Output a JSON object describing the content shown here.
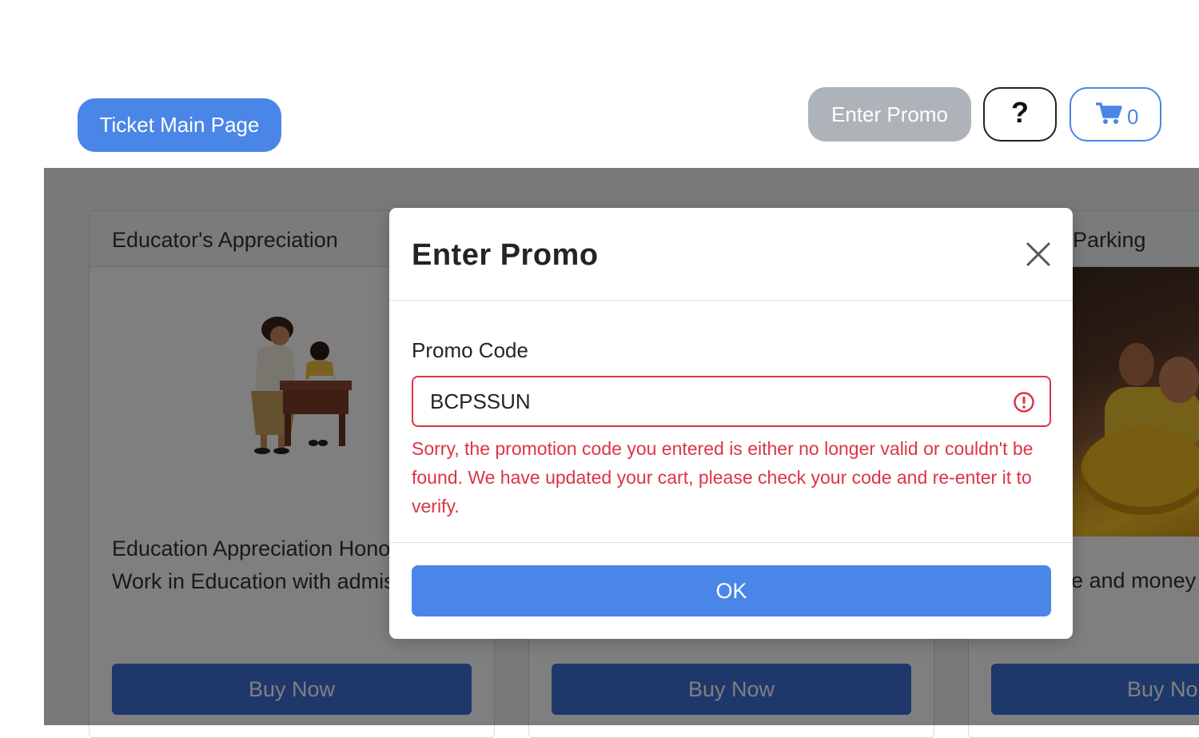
{
  "header": {
    "main_page_label": "Ticket Main Page",
    "enter_promo_label": "Enter Promo",
    "help_label": "?",
    "cart_count": "0"
  },
  "cards": [
    {
      "title": "Educator's Appreciation",
      "description": "Education Appreciation Hono Who Work in Education with admission",
      "buy_label": "Buy Now"
    },
    {
      "title": "",
      "description": "",
      "buy_label": "Buy Now"
    },
    {
      "title": "Parking",
      "description": "e and money",
      "buy_label": "Buy No"
    }
  ],
  "modal": {
    "title": "Enter Promo",
    "field_label": "Promo Code",
    "promo_value": "BCPSSUN",
    "error_message": "Sorry, the promotion code you entered is either no longer valid or couldn't be found. We have updated your cart, please check your code and re-enter it to verify.",
    "ok_label": "OK"
  },
  "colors": {
    "primary": "#4a86e8",
    "error": "#dc3545",
    "disabled": "#aeb3b9"
  }
}
